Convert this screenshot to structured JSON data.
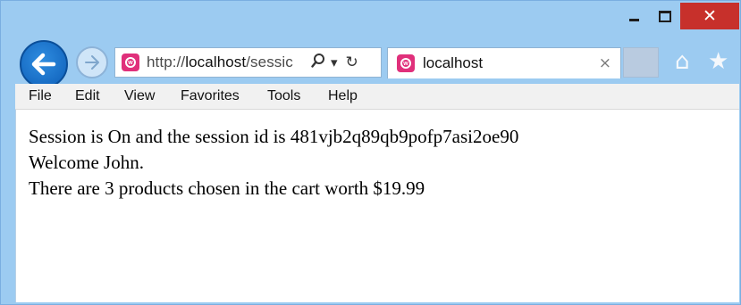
{
  "window": {
    "controls": {
      "minimize": "–",
      "maximize": "□",
      "close": "✕"
    }
  },
  "nav": {
    "back_icon": "back-arrow-icon",
    "forward_icon": "forward-arrow-icon"
  },
  "address_bar": {
    "scheme": "http://",
    "host": "localhost",
    "path": "/sessic",
    "search_glyph": "⚲",
    "dropdown_glyph": "▾",
    "refresh_glyph": "↻"
  },
  "tab": {
    "title": "localhost",
    "close_glyph": "×"
  },
  "toolbar": {
    "home_glyph": "⌂",
    "favorites_glyph": "★"
  },
  "menu": {
    "items": [
      "File",
      "Edit",
      "View",
      "Favorites",
      "Tools",
      "Help"
    ]
  },
  "page": {
    "lines": [
      "Session is On and the session id is 481vjb2q89qb9pofp7asi2oe90",
      "Welcome John.",
      "There are 3 products chosen in the cart worth $19.99"
    ]
  },
  "colors": {
    "frame": "#9ccbf1",
    "close_button": "#c7302b",
    "back_button": "#1f74cc",
    "site_icon": "#e0307b"
  }
}
